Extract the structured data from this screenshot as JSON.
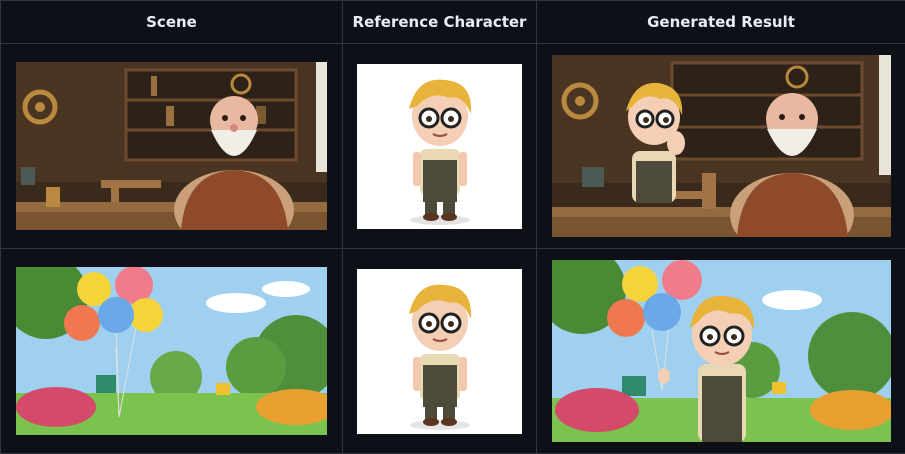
{
  "table": {
    "headers": {
      "scene": "Scene",
      "reference": "Reference Character",
      "result": "Generated Result"
    },
    "rows": [
      {
        "scene_image": "workshop scene with old bearded craftsman at wooden workbench",
        "reference_image": "cartoon boy with blond hair, round glasses and brown overalls",
        "result_image": "cartoon boy leaning on workbench next to old craftsman in workshop"
      },
      {
        "scene_image": "sunny park with colorful balloons and flowers",
        "reference_image": "cartoon boy with blond hair, round glasses and brown overalls",
        "result_image": "cartoon boy holding colorful balloons in sunny park"
      }
    ]
  },
  "colors": {
    "background": "#0d1117",
    "border": "#30363d",
    "header_text": "#e6edf3"
  }
}
